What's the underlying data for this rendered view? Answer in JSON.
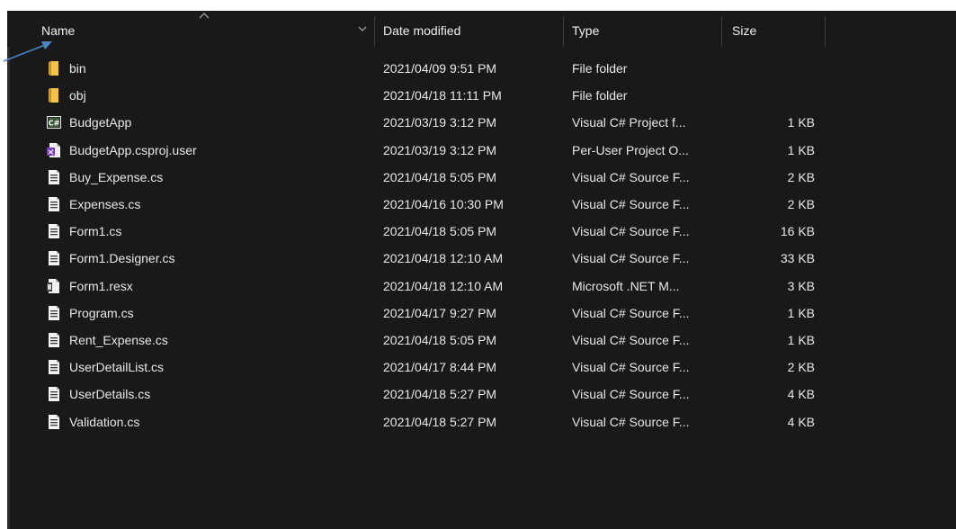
{
  "header": {
    "columns": [
      {
        "label": "Name"
      },
      {
        "label": "Date modified"
      },
      {
        "label": "Type"
      },
      {
        "label": "Size"
      }
    ]
  },
  "files": [
    {
      "name": "bin",
      "icon": "folder-icon",
      "date": "2021/04/09 9:51 PM",
      "type": "File folder",
      "size": ""
    },
    {
      "name": "obj",
      "icon": "folder-icon",
      "date": "2021/04/18 11:11 PM",
      "type": "File folder",
      "size": ""
    },
    {
      "name": "BudgetApp",
      "icon": "csharp-project-icon",
      "date": "2021/03/19 3:12 PM",
      "type": "Visual C# Project f...",
      "size": "1 KB"
    },
    {
      "name": "BudgetApp.csproj.user",
      "icon": "vs-user-file-icon",
      "date": "2021/03/19 3:12 PM",
      "type": "Per-User Project O...",
      "size": "1 KB"
    },
    {
      "name": "Buy_Expense.cs",
      "icon": "source-file-icon",
      "date": "2021/04/18 5:05 PM",
      "type": "Visual C# Source F...",
      "size": "2 KB"
    },
    {
      "name": "Expenses.cs",
      "icon": "source-file-icon",
      "date": "2021/04/16 10:30 PM",
      "type": "Visual C# Source F...",
      "size": "2 KB"
    },
    {
      "name": "Form1.cs",
      "icon": "source-file-icon",
      "date": "2021/04/18 5:05 PM",
      "type": "Visual C# Source F...",
      "size": "16 KB"
    },
    {
      "name": "Form1.Designer.cs",
      "icon": "source-file-icon",
      "date": "2021/04/18 12:10 AM",
      "type": "Visual C# Source F...",
      "size": "33 KB"
    },
    {
      "name": "Form1.resx",
      "icon": "resx-file-icon",
      "date": "2021/04/18 12:10 AM",
      "type": "Microsoft .NET M...",
      "size": "3 KB"
    },
    {
      "name": "Program.cs",
      "icon": "source-file-icon",
      "date": "2021/04/17 9:27 PM",
      "type": "Visual C# Source F...",
      "size": "1 KB"
    },
    {
      "name": "Rent_Expense.cs",
      "icon": "source-file-icon",
      "date": "2021/04/18 5:05 PM",
      "type": "Visual C# Source F...",
      "size": "1 KB"
    },
    {
      "name": "UserDetailList.cs",
      "icon": "source-file-icon",
      "date": "2021/04/17 8:44 PM",
      "type": "Visual C# Source F...",
      "size": "2 KB"
    },
    {
      "name": "UserDetails.cs",
      "icon": "source-file-icon",
      "date": "2021/04/18 5:27 PM",
      "type": "Visual C# Source F...",
      "size": "4 KB"
    },
    {
      "name": "Validation.cs",
      "icon": "source-file-icon",
      "date": "2021/04/18 5:27 PM",
      "type": "Visual C# Source F...",
      "size": "4 KB"
    }
  ],
  "colors": {
    "background": "#191919",
    "text": "#e8e8e8",
    "folder": "#e8b84a",
    "annotation_arrow": "#4a86c5"
  }
}
